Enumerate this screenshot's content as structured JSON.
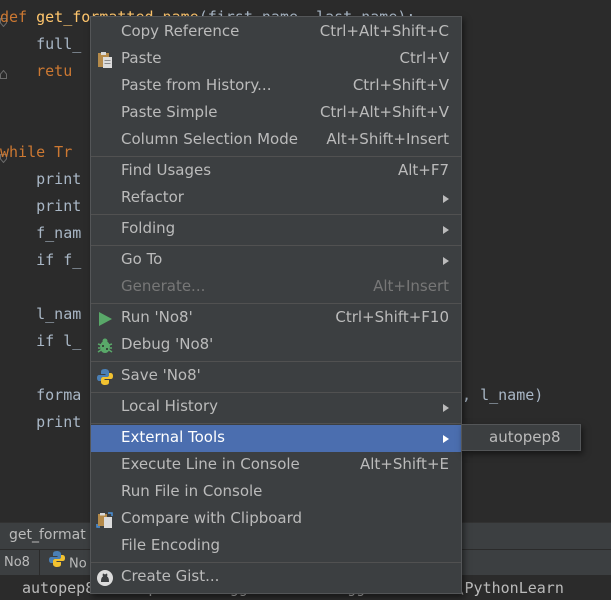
{
  "editor": {
    "lines": [
      {
        "k": "def",
        "f": "get_formatted_name",
        "r": "(first_name, last_name):"
      },
      {
        "t": "    full_"
      },
      {
        "t": "    retu"
      },
      {
        "k": "while",
        "r": " Tr"
      },
      {
        "t": "    print"
      },
      {
        "t": "    print"
      },
      {
        "t": "    f_nam"
      },
      {
        "t": "    if f_"
      },
      {
        "t": "    l_nam"
      },
      {
        "t": "    if l_"
      },
      {
        "t": "    forma",
        "tail": "e, l_name)"
      },
      {
        "t": "    print"
      }
    ]
  },
  "breadcrumb": {
    "text": "get_format"
  },
  "run_tabs": [
    {
      "label": "No8"
    },
    {
      "label": "No"
    }
  ],
  "console": {
    "text": "autopep8 --in-place --aggressive --aggressive E:\\PythonLearn"
  },
  "menu": {
    "items": [
      {
        "label": "Copy Reference",
        "shortcut": "Ctrl+Alt+Shift+C"
      },
      {
        "label": "Paste",
        "shortcut": "Ctrl+V",
        "icon": "clipboard-icon"
      },
      {
        "label": "Paste from History...",
        "shortcut": "Ctrl+Shift+V"
      },
      {
        "label": "Paste Simple",
        "shortcut": "Ctrl+Alt+Shift+V"
      },
      {
        "label": "Column Selection Mode",
        "shortcut": "Alt+Shift+Insert"
      },
      {
        "label": "Find Usages",
        "shortcut": "Alt+F7"
      },
      {
        "label": "Refactor",
        "shortcut": ""
      },
      {
        "label": "Folding",
        "shortcut": ""
      },
      {
        "label": "Go To",
        "shortcut": ""
      },
      {
        "label": "Generate...",
        "shortcut": "Alt+Insert"
      },
      {
        "label": "Run 'No8'",
        "shortcut": "Ctrl+Shift+F10",
        "icon": "run-icon"
      },
      {
        "label": "Debug 'No8'",
        "shortcut": "",
        "icon": "debug-icon"
      },
      {
        "label": "Save 'No8'",
        "shortcut": "",
        "icon": "python-icon"
      },
      {
        "label": "Local History",
        "shortcut": ""
      },
      {
        "label": "External Tools",
        "shortcut": ""
      },
      {
        "label": "Execute Line in Console",
        "shortcut": "Alt+Shift+E"
      },
      {
        "label": "Run File in Console",
        "shortcut": ""
      },
      {
        "label": "Compare with Clipboard",
        "shortcut": "",
        "icon": "compare-icon"
      },
      {
        "label": "File Encoding",
        "shortcut": ""
      },
      {
        "label": "Create Gist...",
        "shortcut": "",
        "icon": "github-icon"
      }
    ]
  },
  "submenu": {
    "items": [
      {
        "label": "autopep8"
      }
    ]
  },
  "colors": {
    "selected": "#4b6eaf",
    "menu_bg": "#3c3f41",
    "editor_bg": "#2b2b2b"
  }
}
